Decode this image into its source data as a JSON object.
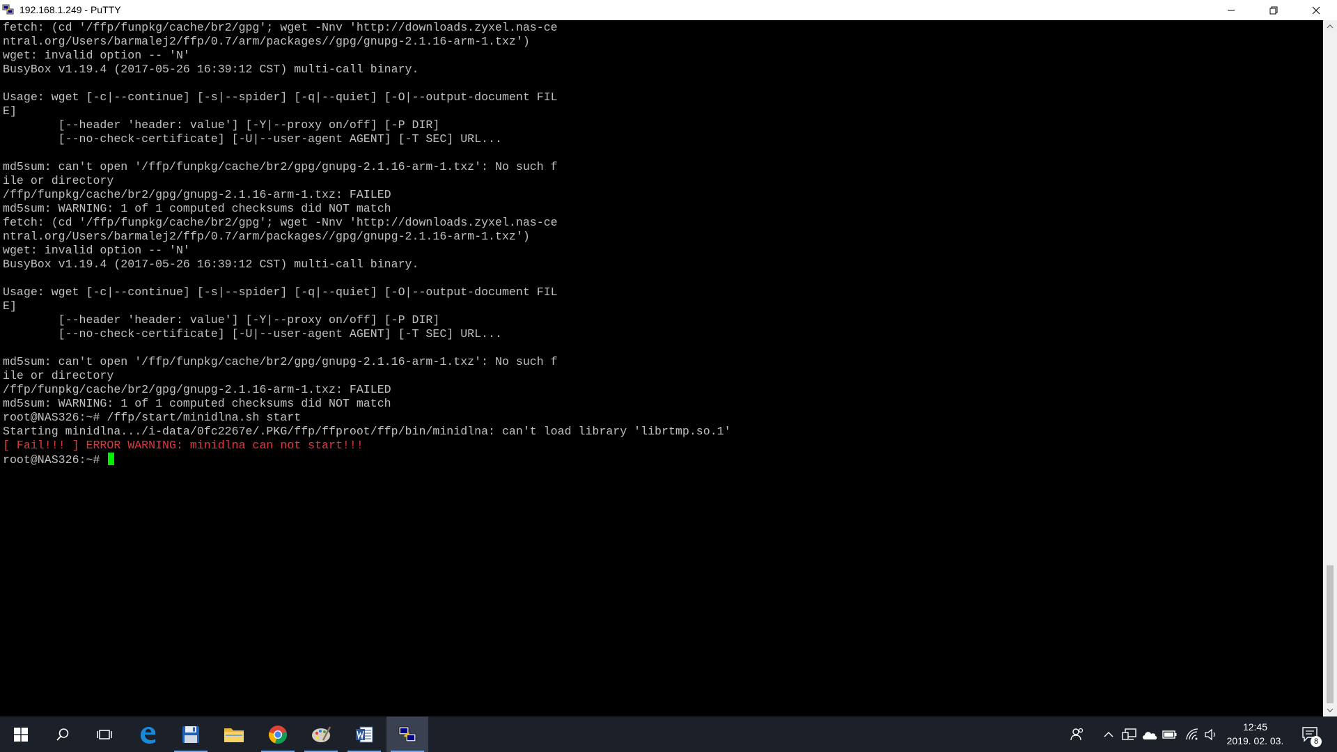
{
  "window": {
    "title": "192.168.1.249 - PuTTY",
    "icon": "putty-icon",
    "controls": [
      "minimize-icon",
      "restore-icon",
      "close-icon"
    ]
  },
  "terminal": {
    "lines": [
      {
        "text": "fetch: (cd '/ffp/funpkg/cache/br2/gpg'; wget -Nnv 'http://downloads.zyxel.nas-ce",
        "color": "#c0c0c0"
      },
      {
        "text": "ntral.org/Users/barmalej2/ffp/0.7/arm/packages//gpg/gnupg-2.1.16-arm-1.txz')",
        "color": "#c0c0c0"
      },
      {
        "text": "wget: invalid option -- 'N'",
        "color": "#c0c0c0"
      },
      {
        "text": "BusyBox v1.19.4 (2017-05-26 16:39:12 CST) multi-call binary.",
        "color": "#c0c0c0"
      },
      {
        "text": "",
        "color": "#c0c0c0"
      },
      {
        "text": "Usage: wget [-c|--continue] [-s|--spider] [-q|--quiet] [-O|--output-document FIL",
        "color": "#c0c0c0"
      },
      {
        "text": "E]",
        "color": "#c0c0c0"
      },
      {
        "text": "        [--header 'header: value'] [-Y|--proxy on/off] [-P DIR]",
        "color": "#c0c0c0"
      },
      {
        "text": "        [--no-check-certificate] [-U|--user-agent AGENT] [-T SEC] URL...",
        "color": "#c0c0c0"
      },
      {
        "text": "",
        "color": "#c0c0c0"
      },
      {
        "text": "md5sum: can't open '/ffp/funpkg/cache/br2/gpg/gnupg-2.1.16-arm-1.txz': No such f",
        "color": "#c0c0c0"
      },
      {
        "text": "ile or directory",
        "color": "#c0c0c0"
      },
      {
        "text": "/ffp/funpkg/cache/br2/gpg/gnupg-2.1.16-arm-1.txz: FAILED",
        "color": "#c0c0c0"
      },
      {
        "text": "md5sum: WARNING: 1 of 1 computed checksums did NOT match",
        "color": "#c0c0c0"
      },
      {
        "text": "fetch: (cd '/ffp/funpkg/cache/br2/gpg'; wget -Nnv 'http://downloads.zyxel.nas-ce",
        "color": "#c0c0c0"
      },
      {
        "text": "ntral.org/Users/barmalej2/ffp/0.7/arm/packages//gpg/gnupg-2.1.16-arm-1.txz')",
        "color": "#c0c0c0"
      },
      {
        "text": "wget: invalid option -- 'N'",
        "color": "#c0c0c0"
      },
      {
        "text": "BusyBox v1.19.4 (2017-05-26 16:39:12 CST) multi-call binary.",
        "color": "#c0c0c0"
      },
      {
        "text": "",
        "color": "#c0c0c0"
      },
      {
        "text": "Usage: wget [-c|--continue] [-s|--spider] [-q|--quiet] [-O|--output-document FIL",
        "color": "#c0c0c0"
      },
      {
        "text": "E]",
        "color": "#c0c0c0"
      },
      {
        "text": "        [--header 'header: value'] [-Y|--proxy on/off] [-P DIR]",
        "color": "#c0c0c0"
      },
      {
        "text": "        [--no-check-certificate] [-U|--user-agent AGENT] [-T SEC] URL...",
        "color": "#c0c0c0"
      },
      {
        "text": "",
        "color": "#c0c0c0"
      },
      {
        "text": "md5sum: can't open '/ffp/funpkg/cache/br2/gpg/gnupg-2.1.16-arm-1.txz': No such f",
        "color": "#c0c0c0"
      },
      {
        "text": "ile or directory",
        "color": "#c0c0c0"
      },
      {
        "text": "/ffp/funpkg/cache/br2/gpg/gnupg-2.1.16-arm-1.txz: FAILED",
        "color": "#c0c0c0"
      },
      {
        "text": "md5sum: WARNING: 1 of 1 computed checksums did NOT match",
        "color": "#c0c0c0"
      },
      {
        "text": "root@NAS326:~# /ffp/start/minidlna.sh start",
        "color": "#c0c0c0"
      },
      {
        "text": "Starting minidlna.../i-data/0fc2267e/.PKG/ffp/ffproot/ffp/bin/minidlna: can't load library 'librtmp.so.1'",
        "color": "#c0c0c0"
      },
      {
        "text": "[ Fail!!! ] ERROR WARNING: minidlna can not start!!!",
        "color": "#e0383f"
      },
      {
        "text": "root@NAS326:~# ",
        "color": "#c0c0c0",
        "cursor": true
      }
    ],
    "cursor_color": "#00ee00"
  },
  "taskbar": {
    "apps": [
      {
        "name": "start-button",
        "icon": "windows-logo-icon"
      },
      {
        "name": "search-button",
        "icon": "search-icon"
      },
      {
        "name": "task-view-button",
        "icon": "task-view-icon"
      },
      {
        "name": "taskbar-edge",
        "icon": "edge-icon"
      },
      {
        "name": "taskbar-save-app",
        "icon": "floppy-disk-icon",
        "running": true
      },
      {
        "name": "taskbar-file-explorer",
        "icon": "folder-icon"
      },
      {
        "name": "taskbar-chrome",
        "icon": "chrome-icon",
        "running": true
      },
      {
        "name": "taskbar-paint",
        "icon": "paint-palette-icon",
        "running": true
      },
      {
        "name": "taskbar-word",
        "icon": "word-icon",
        "running": true
      },
      {
        "name": "taskbar-putty",
        "icon": "putty-icon",
        "running": true,
        "active": true
      }
    ],
    "tray": [
      "people-icon",
      "chevron-up-icon",
      "network-device-icon",
      "onedrive-cloud-icon",
      "battery-icon",
      "wifi-icon",
      "volume-icon"
    ],
    "clock": {
      "time": "12:45",
      "date": "2019. 02. 03."
    },
    "notifications": {
      "icon": "action-center-icon",
      "count": "8"
    }
  }
}
